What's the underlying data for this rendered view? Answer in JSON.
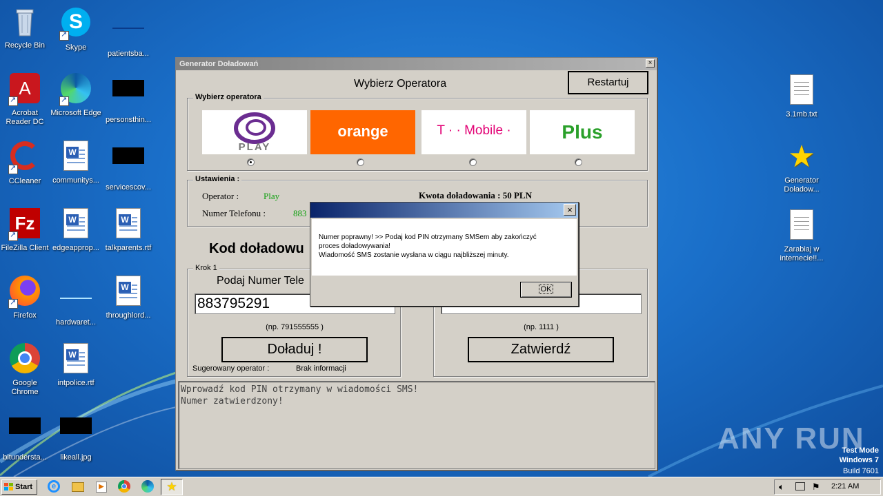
{
  "desktop": {
    "icons": [
      {
        "label": "Recycle Bin"
      },
      {
        "label": "Skype"
      },
      {
        "label": "patientsba..."
      },
      {
        "label": "Acrobat Reader DC"
      },
      {
        "label": "Microsoft Edge"
      },
      {
        "label": "personsthin..."
      },
      {
        "label": "CCleaner"
      },
      {
        "label": "communitys..."
      },
      {
        "label": "servicescov..."
      },
      {
        "label": "FileZilla Client"
      },
      {
        "label": "edgeapprop..."
      },
      {
        "label": "talkparents.rtf"
      },
      {
        "label": "Firefox"
      },
      {
        "label": "hardwaret..."
      },
      {
        "label": "throughlord..."
      },
      {
        "label": "Google Chrome"
      },
      {
        "label": "intpolice.rtf"
      },
      {
        "label": "bitundersta..."
      },
      {
        "label": "likeall.jpg"
      },
      {
        "label": "3.1mb.txt"
      },
      {
        "label": "Generator Doładow..."
      },
      {
        "label": "Zarabiaj w internecie!!..."
      }
    ]
  },
  "app": {
    "title": "Generator Doładowań",
    "close": "×",
    "header": "Wybierz Operatora",
    "restart": "Restartuj",
    "operator_group": "Wybierz operatora",
    "operators": [
      {
        "name": "PLAY",
        "selected": true
      },
      {
        "name": "orange",
        "selected": false
      },
      {
        "name": "T · · Mobile ·",
        "selected": false
      },
      {
        "name": "Plus",
        "selected": false
      }
    ],
    "settings": {
      "group": "Ustawienia :",
      "operator_label": "Operator :",
      "operator_value": "Play",
      "phone_label": "Numer Telefonu :",
      "phone_value": "883",
      "amount_label": "Kwota doładowania : 50 PLN"
    },
    "code_title": "Kod doładowu",
    "step1": {
      "group": "Krok 1",
      "prompt": "Podaj Numer Tele",
      "input_value": "883795291",
      "example": "(np. 791555555 )",
      "button": "Doładuj !",
      "suggested_label": "Sugerowany operator :",
      "suggested_value": "Brak informacji"
    },
    "step2": {
      "input_value": "",
      "example": "(np. 1111 )",
      "button": "Zatwierdź"
    },
    "log": [
      "Wprowadź kod PIN otrzymany w wiadomości SMS!",
      "Numer zatwierdzony!"
    ]
  },
  "dialog": {
    "line1": "Numer poprawny! >> Podaj kod PIN otrzymany SMSem aby zakończyć",
    "line2": "proces doładowywania!",
    "line3": "Wiadomość SMS zostanie wysłana w ciągu najbliższej minuty.",
    "ok": "OK",
    "close": "×"
  },
  "watermark": {
    "brand": "ANY RUN",
    "line1": "Test Mode",
    "line2": "Windows 7",
    "line3": "Build 7601"
  },
  "taskbar": {
    "start": "Start",
    "clock": "2:21 AM"
  },
  "colors": {
    "orange": "#ff6600",
    "play_purple": "#6b2d91",
    "tmobile_magenta": "#e20074",
    "plus_green": "#2aa02a",
    "desktop_blue": "#1a6fc9"
  }
}
